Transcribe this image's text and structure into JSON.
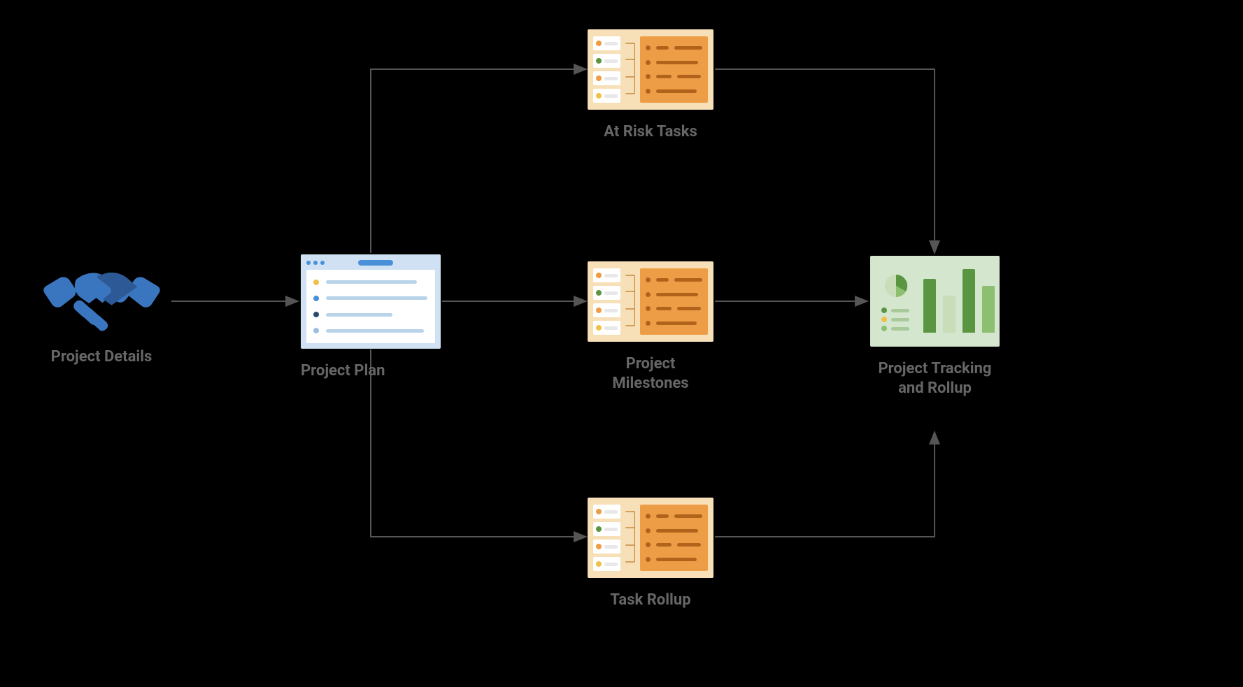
{
  "nodes": {
    "project_details": {
      "label": "Project Details"
    },
    "project_plan": {
      "label": "Project Plan"
    },
    "at_risk_tasks": {
      "label": "At Risk Tasks"
    },
    "project_milestones": {
      "label": "Project Milestones"
    },
    "task_rollup": {
      "label": "Task Rollup"
    },
    "project_tracking": {
      "label": "Project Tracking and Rollup"
    }
  },
  "edges": [
    {
      "from": "project_details",
      "to": "project_plan"
    },
    {
      "from": "project_plan",
      "to": "at_risk_tasks"
    },
    {
      "from": "project_plan",
      "to": "project_milestones"
    },
    {
      "from": "project_plan",
      "to": "task_rollup"
    },
    {
      "from": "at_risk_tasks",
      "to": "project_tracking"
    },
    {
      "from": "project_milestones",
      "to": "project_tracking"
    },
    {
      "from": "task_rollup",
      "to": "project_tracking"
    }
  ],
  "colors": {
    "handshake": "#3a76c0",
    "plan_bg": "#cfe1f2",
    "plan_accent": "#4a90d9",
    "report_bg": "#f7e0b8",
    "report_accent": "#ed9d45",
    "report_dark": "#b2631b",
    "dash_bg": "#d4e6cd",
    "dash_dark": "#5a9641",
    "dash_mid": "#8cbf6f",
    "dash_light": "#c9deb8",
    "arrow": "#555"
  }
}
